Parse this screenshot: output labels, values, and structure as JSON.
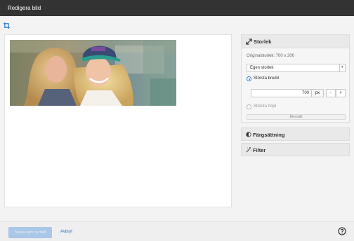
{
  "window": {
    "title": "Redigera bild"
  },
  "toolbar": {
    "crop_icon": "crop-icon"
  },
  "side": {
    "size_panel": {
      "title": "Storlek",
      "icon": "resize-icon",
      "original_size": "Originalstorlek: 700 x 200",
      "mode_select": {
        "value": "Egen storlek"
      },
      "max_width_label": "Största bredd",
      "max_width_value": "700",
      "unit": "px",
      "minus": "-",
      "plus": "+",
      "max_height_label": "Största höjd",
      "reset_label": "Återställ"
    },
    "color_panel": {
      "title": "Färgsättning",
      "icon": "contrast-icon"
    },
    "filter_panel": {
      "title": "Filter",
      "icon": "magic-wand-icon"
    }
  },
  "footer": {
    "save_label": "Spara som ny bild",
    "cancel_label": "Avbryt",
    "help_icon": "help-icon"
  },
  "colors": {
    "accent": "#2f7fd0",
    "titlebar": "#333333",
    "link": "#2f6fb3"
  }
}
